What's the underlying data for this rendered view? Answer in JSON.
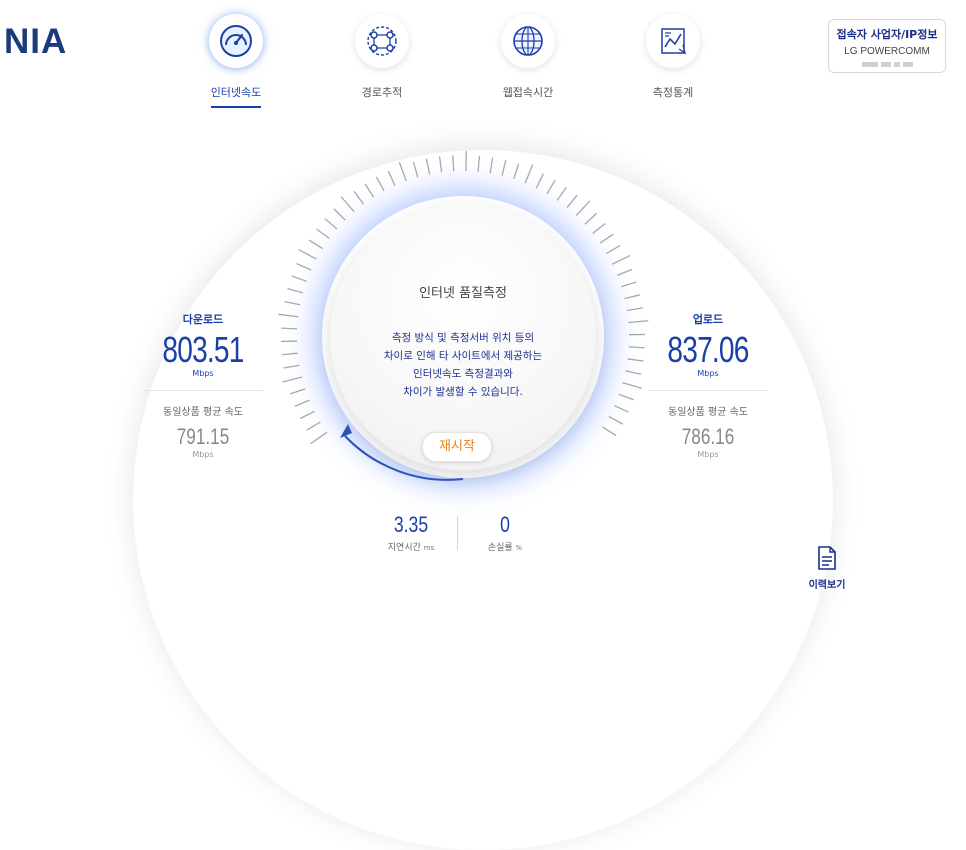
{
  "logo": "NIA",
  "nav": {
    "items": [
      {
        "label": "인터넷속도",
        "icon": "speedometer-icon"
      },
      {
        "label": "경로추적",
        "icon": "route-icon"
      },
      {
        "label": "웹접속시간",
        "icon": "globe-icon"
      },
      {
        "label": "측정통계",
        "icon": "statistics-icon"
      }
    ]
  },
  "isp": {
    "title": "접속자 사업자/IP정보",
    "name": "LG POWERCOMM"
  },
  "gauge": {
    "title": "인터넷 품질측정",
    "message": [
      "측정 방식 및 측정서버 위치 등의",
      "차이로 인해 타 사이트에서 제공하는",
      "인터넷속도 측정결과와",
      "차이가 발생할 수 있습니다."
    ],
    "restart": "재시작"
  },
  "download": {
    "title": "다운로드",
    "value": "803.51",
    "unit": "Mbps",
    "avg_label": "동일상품 평균 속도",
    "avg_value": "791.15",
    "avg_unit": "Mbps"
  },
  "upload": {
    "title": "업로드",
    "value": "837.06",
    "unit": "Mbps",
    "avg_label": "동일상품 평균 속도",
    "avg_value": "786.16",
    "avg_unit": "Mbps"
  },
  "latency": {
    "value": "3.35",
    "label": "지연시간",
    "unit": "ms"
  },
  "loss": {
    "value": "0",
    "label": "손실률",
    "unit": "%"
  },
  "history": {
    "label": "이력보기",
    "icon": "document-icon"
  },
  "colors": {
    "primary": "#1b3fa8",
    "accent": "#f07f1e",
    "glow": "#6e96ff"
  }
}
